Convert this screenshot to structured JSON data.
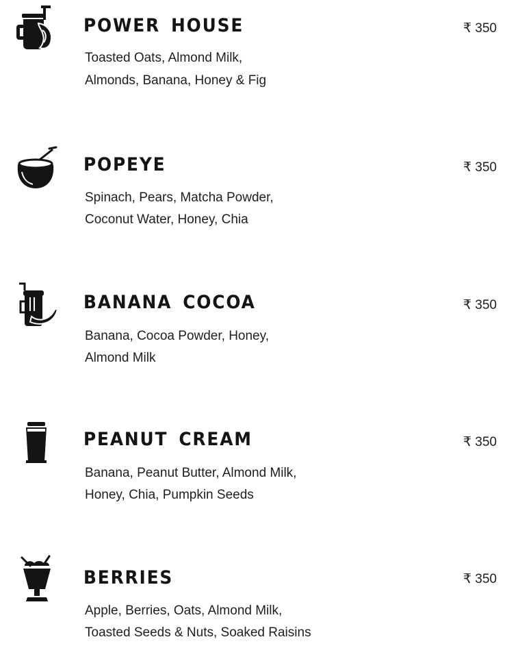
{
  "menu": {
    "items": [
      {
        "name": "POWER HOUSE",
        "line1": "Toasted Oats, Almond Milk,",
        "line2": "Almonds, Banana, Honey & Fig",
        "price": "₹ 350",
        "icon": "mason-jar-banana-icon"
      },
      {
        "name": "POPEYE",
        "line1": "Spinach, Pears, Matcha Powder,",
        "line2": "Coconut Water, Honey, Chia",
        "price": "₹ 350",
        "icon": "coconut-drink-icon"
      },
      {
        "name": "BANANA COCOA",
        "line1": "Banana, Cocoa Powder, Honey,",
        "line2": "Almond Milk",
        "price": "₹ 350",
        "icon": "banana-shake-icon"
      },
      {
        "name": "PEANUT CREAM",
        "line1": "Banana, Peanut Butter, Almond Milk,",
        "line2": "Honey, Chia, Pumpkin Seeds",
        "price": "₹ 350",
        "icon": "tall-glass-icon"
      },
      {
        "name": "BERRIES",
        "line1": "Apple, Berries, Oats, Almond Milk,",
        "line2": "Toasted Seeds & Nuts, Soaked Raisins",
        "price": "₹ 350",
        "icon": "sundae-glass-icon"
      }
    ]
  }
}
